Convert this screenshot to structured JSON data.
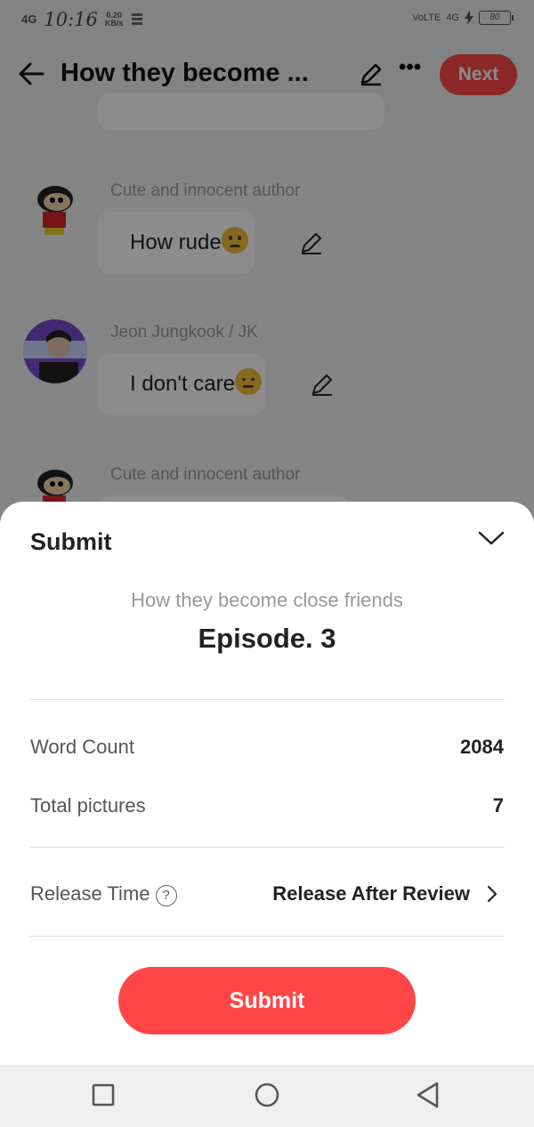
{
  "status_bar": {
    "network": "4G",
    "time": "10:16",
    "speed_value": "0.20",
    "speed_unit": "KB/s",
    "volte": "VoLTE",
    "network_right": "4G",
    "battery": "80"
  },
  "header": {
    "title": "How they become ...",
    "next_label": "Next"
  },
  "messages": [
    {
      "author": "Cute and innocent author",
      "text": "How rude",
      "emoji": "frowning-emoji"
    },
    {
      "author": "Jeon Jungkook / JK",
      "text": "I don't care",
      "emoji": "expressionless-emoji"
    },
    {
      "author": "Cute and innocent author"
    }
  ],
  "sheet": {
    "title": "Submit",
    "story_title": "How they become close friends",
    "episode": "Episode. 3",
    "word_count_label": "Word Count",
    "word_count_value": "2084",
    "total_pictures_label": "Total pictures",
    "total_pictures_value": "7",
    "release_time_label": "Release Time",
    "help_symbol": "?",
    "release_time_value": "Release After Review",
    "submit_label": "Submit"
  },
  "colors": {
    "accent": "#ff4647",
    "text_primary": "#222222",
    "text_secondary": "#999999"
  },
  "icons": [
    "back-arrow-icon",
    "pencil-icon",
    "more-icon",
    "chevron-down-icon",
    "chevron-right-icon",
    "help-icon",
    "square-nav-icon",
    "circle-nav-icon",
    "triangle-nav-icon"
  ]
}
